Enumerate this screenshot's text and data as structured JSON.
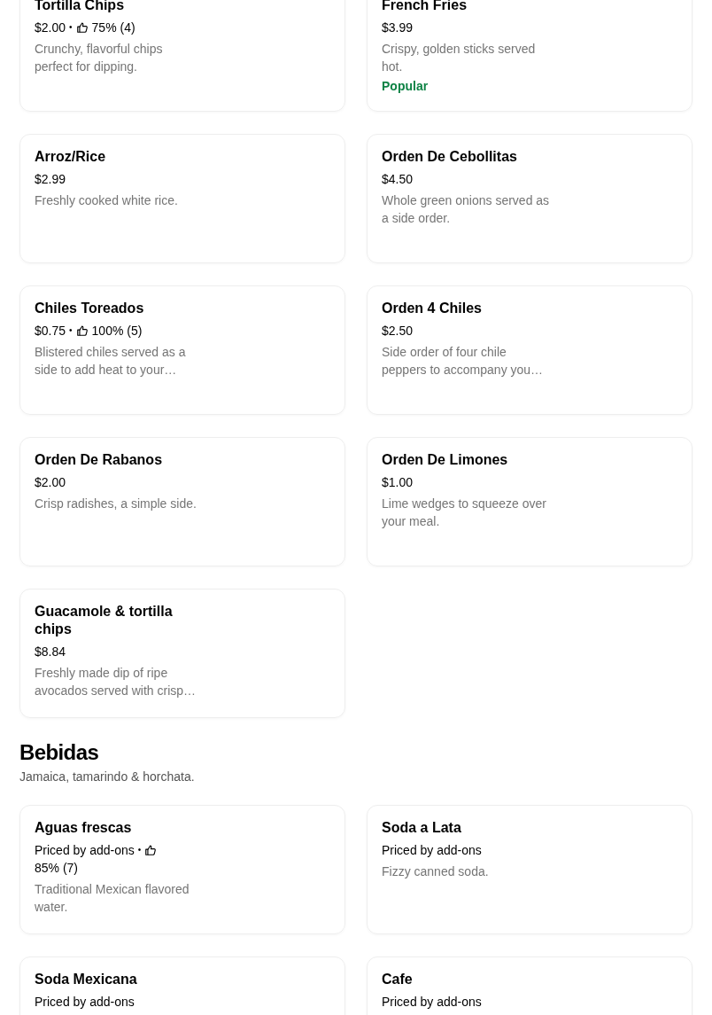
{
  "sections": [
    {
      "items": [
        {
          "name": "Tortilla Chips",
          "price": "$2.00",
          "rating": {
            "separator": "•",
            "score": "75% (4)"
          },
          "description": "Crunchy, flavorful chips perfect for dipping."
        },
        {
          "name": "French Fries",
          "price": "$3.99",
          "description": "Crispy, golden sticks served hot.",
          "badge": "Popular"
        },
        {
          "name": "Arroz/Rice",
          "price": "$2.99",
          "description": "Freshly cooked white rice."
        },
        {
          "name": "Orden De Cebollitas",
          "price": "$4.50",
          "description": "Whole green onions served as a side order."
        },
        {
          "name": "Chiles Toreados",
          "price": "$0.75",
          "rating": {
            "separator": "•",
            "score": "100% (5)"
          },
          "description": "Blistered chiles served as a side to add heat to your…"
        },
        {
          "name": "Orden 4 Chiles",
          "price": "$2.50",
          "description": "Side order of four chile peppers to accompany you…"
        },
        {
          "name": "Orden De Rabanos",
          "price": "$2.00",
          "description": "Crisp radishes, a simple side."
        },
        {
          "name": "Orden De Limones",
          "price": "$1.00",
          "description": "Lime wedges to squeeze over your meal."
        },
        {
          "name": "Guacamole & tortilla chips",
          "price": "$8.84",
          "description": "Freshly made dip of ripe avocados served with crisp…"
        }
      ]
    },
    {
      "title": "Bebidas",
      "description": "Jamaica, tamarindo & horchata.",
      "items": [
        {
          "name": "Aguas frescas",
          "price": "Priced by add-ons",
          "rating": {
            "separator": "•",
            "score": "85% (7)"
          },
          "description": "Traditional Mexican flavored water."
        },
        {
          "name": "Soda a Lata",
          "price": "Priced by add-ons",
          "description": "Fizzy canned soda."
        },
        {
          "name": "Soda Mexicana",
          "price": "Priced by add-ons"
        },
        {
          "name": "Cafe",
          "price": "Priced by add-ons"
        }
      ]
    }
  ]
}
